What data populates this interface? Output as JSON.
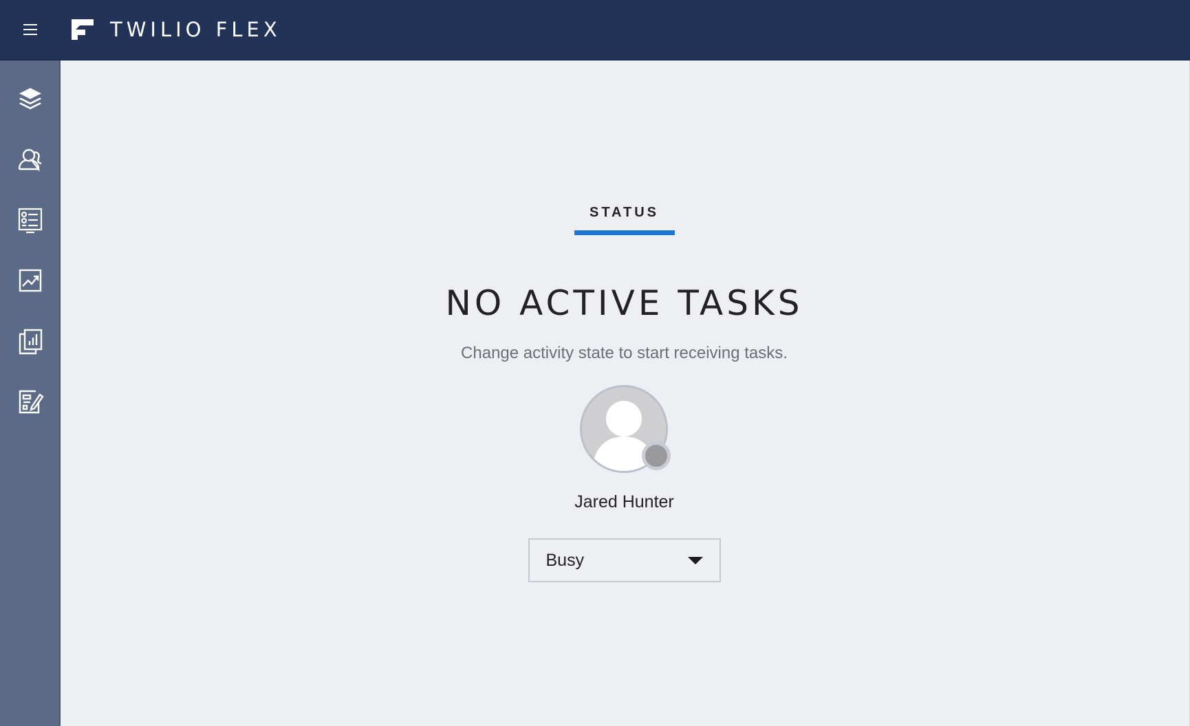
{
  "header": {
    "app_title": "TWILIO FLEX",
    "menu_icon": "hamburger-menu-icon",
    "logo_icon": "twilio-flex-logo",
    "background": "#223357"
  },
  "sidebar": {
    "background": "#5b6a86",
    "items": [
      {
        "icon": "layers-icon"
      },
      {
        "icon": "agents-icon"
      },
      {
        "icon": "task-list-icon"
      },
      {
        "icon": "analytics-icon"
      },
      {
        "icon": "reports-icon"
      },
      {
        "icon": "edit-form-icon"
      }
    ]
  },
  "main": {
    "tab_label": "STATUS",
    "accent": "#1976d2",
    "headline": "NO ACTIVE TASKS",
    "subtext": "Change activity state to start receiving tasks.",
    "user": {
      "name": "Jared Hunter",
      "avatar_icon": "user-avatar-icon",
      "status_color": "#9a9a9c"
    },
    "activity_select": {
      "value": "Busy",
      "caret_icon": "caret-down-icon"
    }
  }
}
